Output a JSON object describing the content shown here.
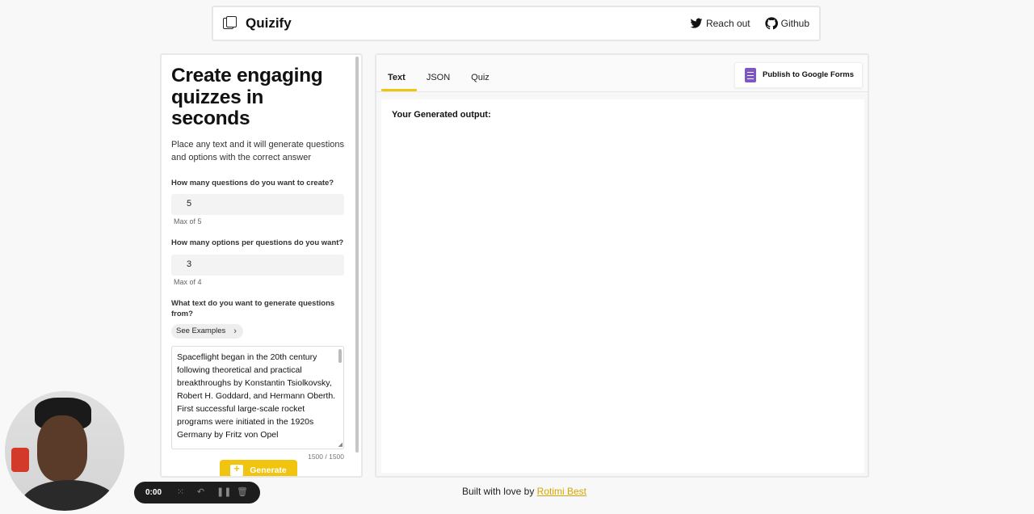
{
  "header": {
    "brand": "Quizify",
    "reach_out": "Reach out",
    "github": "Github"
  },
  "left": {
    "title": "Create engaging quizzes in seconds",
    "subtitle": "Place any text and it will generate questions and options with the correct answer",
    "questions_label": "How many questions do you want to create?",
    "questions_value": "5",
    "questions_hint": "Max of 5",
    "options_label": "How many options per questions do you want?",
    "options_value": "3",
    "options_hint": "Max of 4",
    "text_label": "What text do you want to generate questions from?",
    "examples_button": "See Examples",
    "text_value": "Spaceflight began in the 20th century following theoretical and practical breakthroughs by Konstantin Tsiolkovsky, Robert H. Goddard, and Hermann Oberth. First successful large-scale rocket programs were initiated in the 1920s Germany by Fritz von Opel",
    "counter": "1500 / 1500",
    "generate_button": "Generate"
  },
  "right": {
    "tabs": [
      "Text",
      "JSON",
      "Quiz"
    ],
    "active_tab": "Text",
    "publish_button": "Publish to Google Forms",
    "output_label": "Your Generated output:"
  },
  "footer": {
    "text": "Built with love by",
    "author": "Rotimi Best"
  },
  "recorder": {
    "time": "0:00"
  },
  "colors": {
    "accent": "#f1c40f",
    "forms_purple": "#7e57c2"
  }
}
